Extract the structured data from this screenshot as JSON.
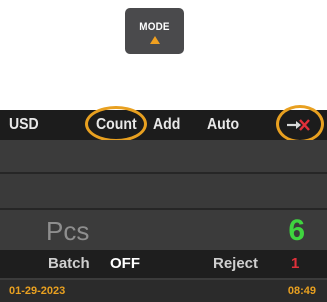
{
  "mode_button": {
    "label": "MODE",
    "indicator": "up-triangle",
    "indicator_color": "#f0a020"
  },
  "display": {
    "currency": "USD",
    "modes": [
      "Count",
      "Add",
      "Auto"
    ],
    "highlighted": [
      "Count",
      "exit-icon"
    ],
    "highlight_color": "#e8a020",
    "exit_icon": "arrow-exit-with-red-x-icon",
    "pcs": {
      "label": "Pcs",
      "value": "6",
      "value_color": "#3fd43f"
    },
    "batch": {
      "label": "Batch",
      "value": "OFF"
    },
    "reject": {
      "label": "Reject",
      "value": "1",
      "value_color": "#e0303a"
    },
    "status": {
      "date": "01-29-2023",
      "time": "08:49",
      "color": "#e8a020"
    }
  }
}
